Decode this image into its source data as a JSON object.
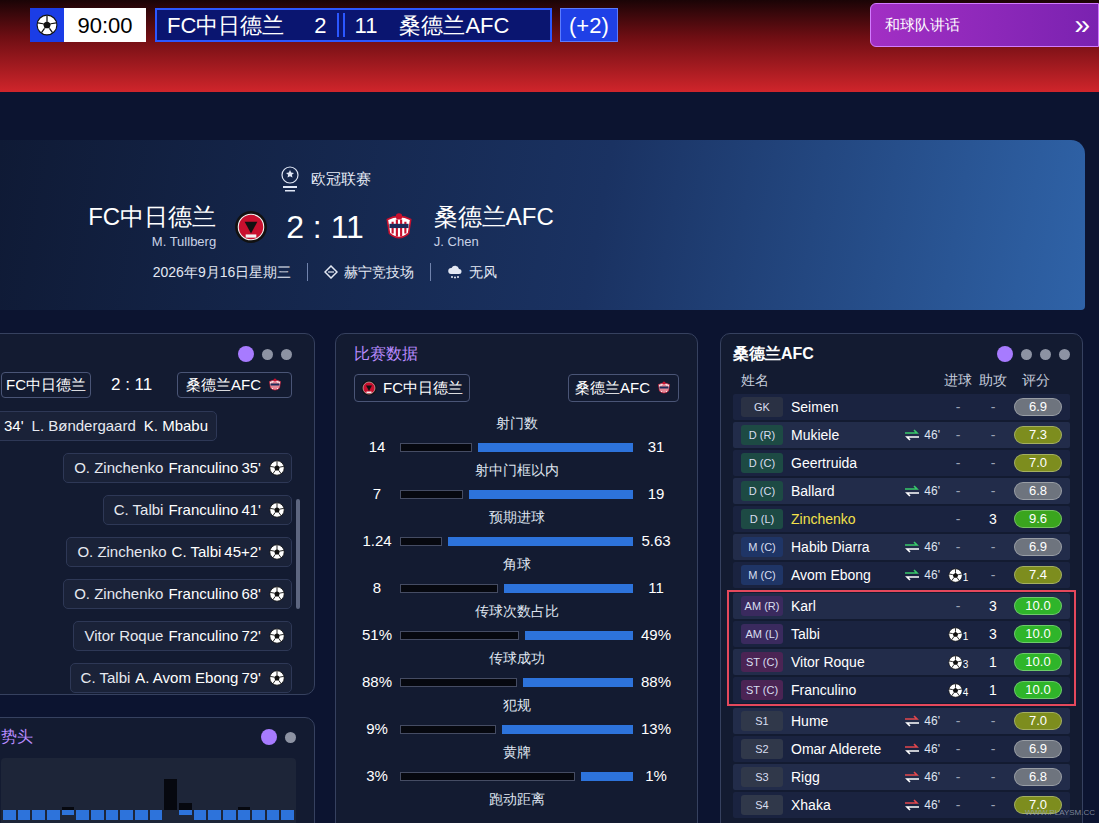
{
  "scorebar": {
    "clock": "90:00",
    "home": "FC中日德兰",
    "home_score": "2",
    "away_score": "11",
    "away": "桑德兰AFC",
    "added": "(+2)"
  },
  "team_talk_button": {
    "label": "和球队讲话",
    "icon": "»"
  },
  "header": {
    "competition": "欧冠联赛",
    "home": {
      "name": "FC中日德兰",
      "manager": "M. Tullberg"
    },
    "score": "2 : 11",
    "away": {
      "name": "桑德兰AFC",
      "manager": "J. Chen"
    },
    "date": "2026年9月16日星期三",
    "stadium": "赫宁竞技场",
    "weather": "无风"
  },
  "events_panel": {
    "pages": [
      {
        "selected": true
      },
      {
        "selected": false
      },
      {
        "selected": false
      }
    ],
    "home": "FC中日德兰",
    "score": "2 : 11",
    "away": "桑德兰AFC",
    "scroll_position": 0.53,
    "events": [
      {
        "side": "home",
        "minute": "34'",
        "first": "L. Bøndergaard",
        "second": "K. Mbabu"
      },
      {
        "side": "away",
        "first": "O. Zinchenko",
        "second": "Franculino",
        "minute": "35'"
      },
      {
        "side": "away",
        "first": "C. Talbi",
        "second": "Franculino",
        "minute": "41'"
      },
      {
        "side": "away",
        "first": "O. Zinchenko",
        "second": "C. Talbi",
        "minute": "45+2'"
      },
      {
        "side": "away",
        "first": "O. Zinchenko",
        "second": "Franculino",
        "minute": "68'"
      },
      {
        "side": "away",
        "first": "Vitor Roque",
        "second": "Franculino",
        "minute": "72'"
      },
      {
        "side": "away",
        "first": "C. Talbi",
        "second": "A. Avom Ebong",
        "minute": "79'"
      }
    ]
  },
  "momentum_panel": {
    "title": "势头",
    "pages": [
      {
        "selected": true
      },
      {
        "selected": false
      }
    ],
    "home": [
      0,
      0,
      0,
      0,
      1,
      0,
      0,
      0,
      0,
      0,
      0,
      9,
      2,
      0,
      0,
      0,
      1,
      0,
      0,
      0
    ],
    "away": [
      2,
      2,
      2,
      2,
      1,
      2,
      2,
      2,
      2,
      2,
      2,
      0,
      1,
      2,
      2,
      2,
      2,
      2,
      2,
      2
    ]
  },
  "stats_panel": {
    "title": "比赛数据",
    "home": "FC中日德兰",
    "away": "桑德兰AFC",
    "stats": [
      {
        "label": "射门数",
        "home": "14",
        "away": "31",
        "level": 0.31
      },
      {
        "label": "射中门框以内",
        "home": "7",
        "away": "19",
        "level": 0.27
      },
      {
        "label": "预期进球",
        "home": "1.24",
        "away": "5.63",
        "level": 0.18
      },
      {
        "label": "角球",
        "home": "8",
        "away": "11",
        "level": 0.42
      },
      {
        "label": "传球次数占比",
        "home": "51%",
        "away": "49%",
        "level": 0.51
      },
      {
        "label": "传球成功",
        "home": "88%",
        "away": "88%",
        "level": 0.5
      },
      {
        "label": "犯规",
        "home": "9%",
        "away": "13%",
        "level": 0.41
      },
      {
        "label": "黄牌",
        "home": "3%",
        "away": "1%",
        "level": 0.75
      },
      {
        "label": "跑动距离"
      }
    ]
  },
  "squad_panel": {
    "title": "桑德兰AFC",
    "pages": [
      {
        "selected": true
      },
      {
        "selected": false
      },
      {
        "selected": false
      },
      {
        "selected": false
      }
    ],
    "columns": [
      "姓名",
      "进球",
      "助攻",
      "评分"
    ],
    "players": [
      {
        "pos": "GK",
        "pos_color": "#2a3144",
        "name": "Seimen",
        "star": false,
        "sub": null,
        "goals": "-",
        "assists": "-",
        "rating": "6.9",
        "rating_color": "#6e747e",
        "highlighted": false
      },
      {
        "pos": "D (R)",
        "pos_color": "#1d4a44",
        "name": "Mukiele",
        "star": false,
        "sub": {
          "minute": "46'",
          "color": "#38c96a"
        },
        "goals": "-",
        "assists": "-",
        "rating": "7.3",
        "rating_color": "#7d8d1e",
        "highlighted": false
      },
      {
        "pos": "D (C)",
        "pos_color": "#1d4a44",
        "name": "Geertruida",
        "star": false,
        "sub": null,
        "goals": "-",
        "assists": "-",
        "rating": "7.0",
        "rating_color": "#7d8d1e",
        "highlighted": false
      },
      {
        "pos": "D (C)",
        "pos_color": "#1d4a44",
        "name": "Ballard",
        "star": false,
        "sub": {
          "minute": "46'",
          "color": "#38c96a"
        },
        "goals": "-",
        "assists": "-",
        "rating": "6.8",
        "rating_color": "#6e747e",
        "highlighted": false
      },
      {
        "pos": "D (L)",
        "pos_color": "#1d4a44",
        "name": "Zinchenko",
        "star": true,
        "sub": null,
        "goals": "-",
        "assists": "3",
        "rating": "9.6",
        "rating_color": "#3aa51e",
        "highlighted": false
      },
      {
        "pos": "M (C)",
        "pos_color": "#1f3566",
        "name": "Habib Diarra",
        "star": false,
        "sub": {
          "minute": "46'",
          "color": "#38c96a"
        },
        "goals": "-",
        "assists": "-",
        "rating": "6.9",
        "rating_color": "#6e747e",
        "highlighted": false
      },
      {
        "pos": "M (C)",
        "pos_color": "#1f3566",
        "name": "Avom Ebong",
        "star": false,
        "sub": {
          "minute": "46'",
          "color": "#38c96a"
        },
        "goals": "1",
        "assists": "-",
        "rating": "7.4",
        "rating_color": "#7d8d1e",
        "highlighted": false
      },
      {
        "pos": "AM (R)",
        "pos_color": "#3a2a5e",
        "name": "Karl",
        "star": false,
        "sub": null,
        "goals": "-",
        "assists": "3",
        "rating": "10.0",
        "rating_color": "#2fb52a",
        "highlighted": true
      },
      {
        "pos": "AM (L)",
        "pos_color": "#3a2a5e",
        "name": "Talbi",
        "star": false,
        "sub": null,
        "goals": "1",
        "assists": "3",
        "rating": "10.0",
        "rating_color": "#2fb52a",
        "highlighted": true
      },
      {
        "pos": "ST (C)",
        "pos_color": "#4b2454",
        "name": "Vitor Roque",
        "star": false,
        "sub": null,
        "goals": "3",
        "assists": "1",
        "rating": "10.0",
        "rating_color": "#2fb52a",
        "highlighted": true
      },
      {
        "pos": "ST (C)",
        "pos_color": "#4b2454",
        "name": "Franculino",
        "star": false,
        "sub": null,
        "goals": "4",
        "assists": "1",
        "rating": "10.0",
        "rating_color": "#2fb52a",
        "highlighted": true
      },
      {
        "pos": "S1",
        "pos_color": "#30384a",
        "name": "Hume",
        "star": false,
        "sub": {
          "minute": "46'",
          "color": "#e4474c"
        },
        "goals": "-",
        "assists": "-",
        "rating": "7.0",
        "rating_color": "#7d8d1e",
        "highlighted": false
      },
      {
        "pos": "S2",
        "pos_color": "#30384a",
        "name": "Omar Alderete",
        "star": false,
        "sub": {
          "minute": "46'",
          "color": "#e4474c"
        },
        "goals": "-",
        "assists": "-",
        "rating": "6.9",
        "rating_color": "#6e747e",
        "highlighted": false
      },
      {
        "pos": "S3",
        "pos_color": "#30384a",
        "name": "Rigg",
        "star": false,
        "sub": {
          "minute": "46'",
          "color": "#e4474c"
        },
        "goals": "-",
        "assists": "-",
        "rating": "6.8",
        "rating_color": "#6e747e",
        "highlighted": false
      },
      {
        "pos": "S4",
        "pos_color": "#30384a",
        "name": "Xhaka",
        "star": false,
        "sub": {
          "minute": "46'",
          "color": "#e4474c"
        },
        "goals": "-",
        "assists": "-",
        "rating": "7.0",
        "rating_color": "#7d8d1e",
        "highlighted": false
      }
    ]
  },
  "watermark": "WWW.PLAYSM.CC"
}
